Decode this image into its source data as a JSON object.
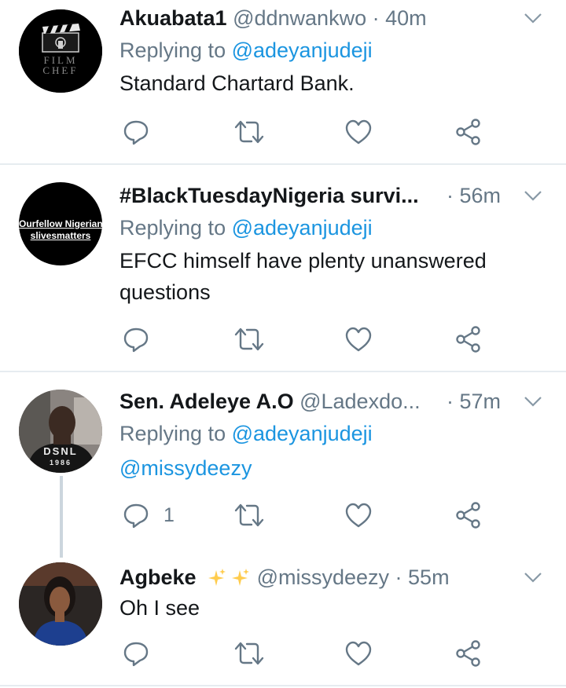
{
  "tweets": [
    {
      "name": "Akuabata1",
      "handle": "@ddnwankwo",
      "sep": " · ",
      "time": "40m",
      "reply_prefix": "Replying to ",
      "reply_to": "@adeyanjudeji",
      "text": "Standard Chartard Bank.",
      "avatar_text": [
        "FILM",
        "CHEF"
      ],
      "reply_count": ""
    },
    {
      "name": "#BlackTuesdayNigeria survi...",
      "handle": "",
      "sep": " · ",
      "time": "56m",
      "reply_prefix": "Replying to ",
      "reply_to": "@adeyanjudeji",
      "text_line1": "EFCC himself have plenty unanswered",
      "text_line2": "questions",
      "avatar_text": [
        "Ourfellow Nigerian",
        "slivesmatters"
      ],
      "reply_count": ""
    },
    {
      "name": "Sen. Adeleye A.O",
      "handle": "@Ladexdo...",
      "sep": " · ",
      "time": "57m",
      "reply_prefix": "Replying to ",
      "reply_to": "@adeyanjudeji",
      "text": "@missydeezy",
      "avatar_text": [
        "DSNL",
        "1986"
      ],
      "reply_count": "1"
    },
    {
      "name": "Agbeke",
      "handle": "@missydeezy",
      "sep": " · ",
      "time": "55m",
      "text": "Oh I see",
      "reply_count": ""
    }
  ],
  "icons": {
    "reply": "reply-icon",
    "retweet": "retweet-icon",
    "like": "heart-icon",
    "share": "share-icon",
    "caret": "chevron-down-icon",
    "sparkles": "sparkles-icon"
  },
  "colors": {
    "link": "#1b95e0",
    "secondary": "#657786",
    "text": "#14171a",
    "divider": "#e6ecf0",
    "sparkle": "#ffcc4d"
  }
}
